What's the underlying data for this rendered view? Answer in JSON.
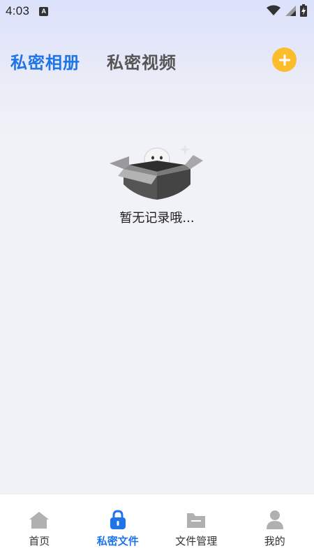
{
  "status_bar": {
    "time": "4:03",
    "badge": "A"
  },
  "tabs": [
    {
      "label": "私密相册",
      "active": true
    },
    {
      "label": "私密视频",
      "active": false
    }
  ],
  "add_button": {
    "icon": "plus-icon",
    "color": "#fbbd2b"
  },
  "empty_state": {
    "icon": "empty-box-icon",
    "message": "暂无记录哦..."
  },
  "bottom_nav": [
    {
      "label": "首页",
      "icon": "home-icon",
      "active": false
    },
    {
      "label": "私密文件",
      "icon": "lock-icon",
      "active": true
    },
    {
      "label": "文件管理",
      "icon": "folder-icon",
      "active": false
    },
    {
      "label": "我的",
      "icon": "person-icon",
      "active": false
    }
  ],
  "colors": {
    "accent": "#1f74e8",
    "add_button": "#fbbd2b",
    "inactive_nav_icon": "#b0b0b0"
  }
}
